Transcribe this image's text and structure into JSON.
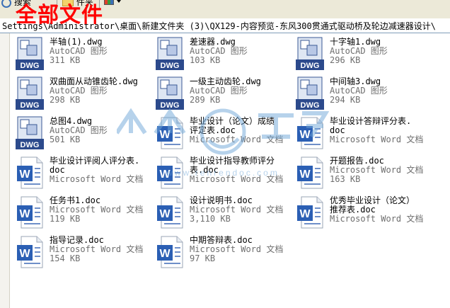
{
  "toolbar": {
    "search_label": "搜索",
    "folder_label": "件夹",
    "view_icon": "views-icon"
  },
  "overlay_title": "全部文件",
  "address": {
    "path": "Settings\\Administrator\\桌面\\新建文件夹 (3)\\QX129-内容预览-东风300贯通式驱动桥及轮边减速器设计\\"
  },
  "watermark": {
    "logo_text": "人人文库",
    "url_text": "www.renrendoc.com"
  },
  "files": [
    {
      "name": "半轴(1).dwg",
      "type": "AutoCAD 图形",
      "size": "311 KB",
      "kind": "dwg"
    },
    {
      "name": "差速器.dwg",
      "type": "AutoCAD 图形",
      "size": "103 KB",
      "kind": "dwg"
    },
    {
      "name": "十字轴1.dwg",
      "type": "AutoCAD 图形",
      "size": "296 KB",
      "kind": "dwg"
    },
    {
      "name": "双曲面从动锥齿轮.dwg",
      "type": "AutoCAD 图形",
      "size": "298 KB",
      "kind": "dwg"
    },
    {
      "name": "一级主动齿轮.dwg",
      "type": "AutoCAD 图形",
      "size": "289 KB",
      "kind": "dwg"
    },
    {
      "name": "中间轴3.dwg",
      "type": "AutoCAD 图形",
      "size": "294 KB",
      "kind": "dwg"
    },
    {
      "name": "总图4.dwg",
      "type": "AutoCAD 图形",
      "size": "501 KB",
      "kind": "dwg"
    },
    {
      "name": "毕业设计（论文）成绩\n评定表.doc",
      "type": "Microsoft Word 文档",
      "size": "",
      "kind": "doc"
    },
    {
      "name": "毕业设计答辩评分表.\ndoc",
      "type": "Microsoft Word 文档",
      "size": "",
      "kind": "doc"
    },
    {
      "name": "毕业设计评阅人评分表.\ndoc",
      "type": "Microsoft Word 文档",
      "size": "",
      "kind": "doc"
    },
    {
      "name": "毕业设计指导教师评分\n表.doc",
      "type": "Microsoft Word 文档",
      "size": "",
      "kind": "doc"
    },
    {
      "name": "开题报告.doc",
      "type": "Microsoft Word 文档",
      "size": "163 KB",
      "kind": "doc"
    },
    {
      "name": "任务书1.doc",
      "type": "Microsoft Word 文档",
      "size": "119 KB",
      "kind": "doc"
    },
    {
      "name": "设计说明书.doc",
      "type": "Microsoft Word 文档",
      "size": "3,110 KB",
      "kind": "doc"
    },
    {
      "name": "优秀毕业设计（论文）\n推荐表.doc",
      "type": "Microsoft Word 文档",
      "size": "",
      "kind": "doc"
    },
    {
      "name": "指导记录.doc",
      "type": "Microsoft Word 文档",
      "size": "154 KB",
      "kind": "doc"
    },
    {
      "name": "中期答辩表.doc",
      "type": "Microsoft Word 文档",
      "size": "97 KB",
      "kind": "doc"
    }
  ],
  "colors": {
    "dwg_badge": "#2c4a8c",
    "word_blue": "#2b5fb4",
    "overlay_red": "#ff0000",
    "watermark_blue": "#6fa6d8"
  }
}
